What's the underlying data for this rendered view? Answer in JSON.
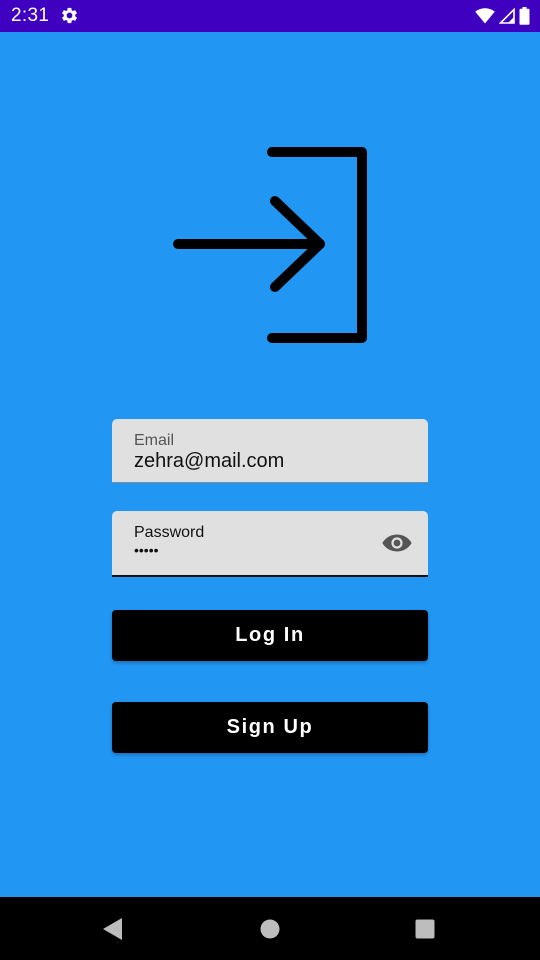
{
  "status_bar": {
    "time": "2:31",
    "icons": [
      "gear-icon",
      "wifi-icon",
      "signal-icon",
      "battery-icon"
    ],
    "background_color": "#3F00BF"
  },
  "theme": {
    "background_color": "#2196F3",
    "button_color": "#000000",
    "field_color": "#E0E0E0"
  },
  "hero": {
    "icon": "login-icon"
  },
  "form": {
    "email": {
      "label": "Email",
      "value": "zehra@mail.com"
    },
    "password": {
      "label": "Password",
      "masked_value": "•••••",
      "toggle_icon": "eye-icon"
    }
  },
  "buttons": {
    "login_label": "Log In",
    "signup_label": "Sign Up"
  },
  "nav_bar": {
    "icons": [
      "back-icon",
      "home-icon",
      "recents-icon"
    ]
  }
}
